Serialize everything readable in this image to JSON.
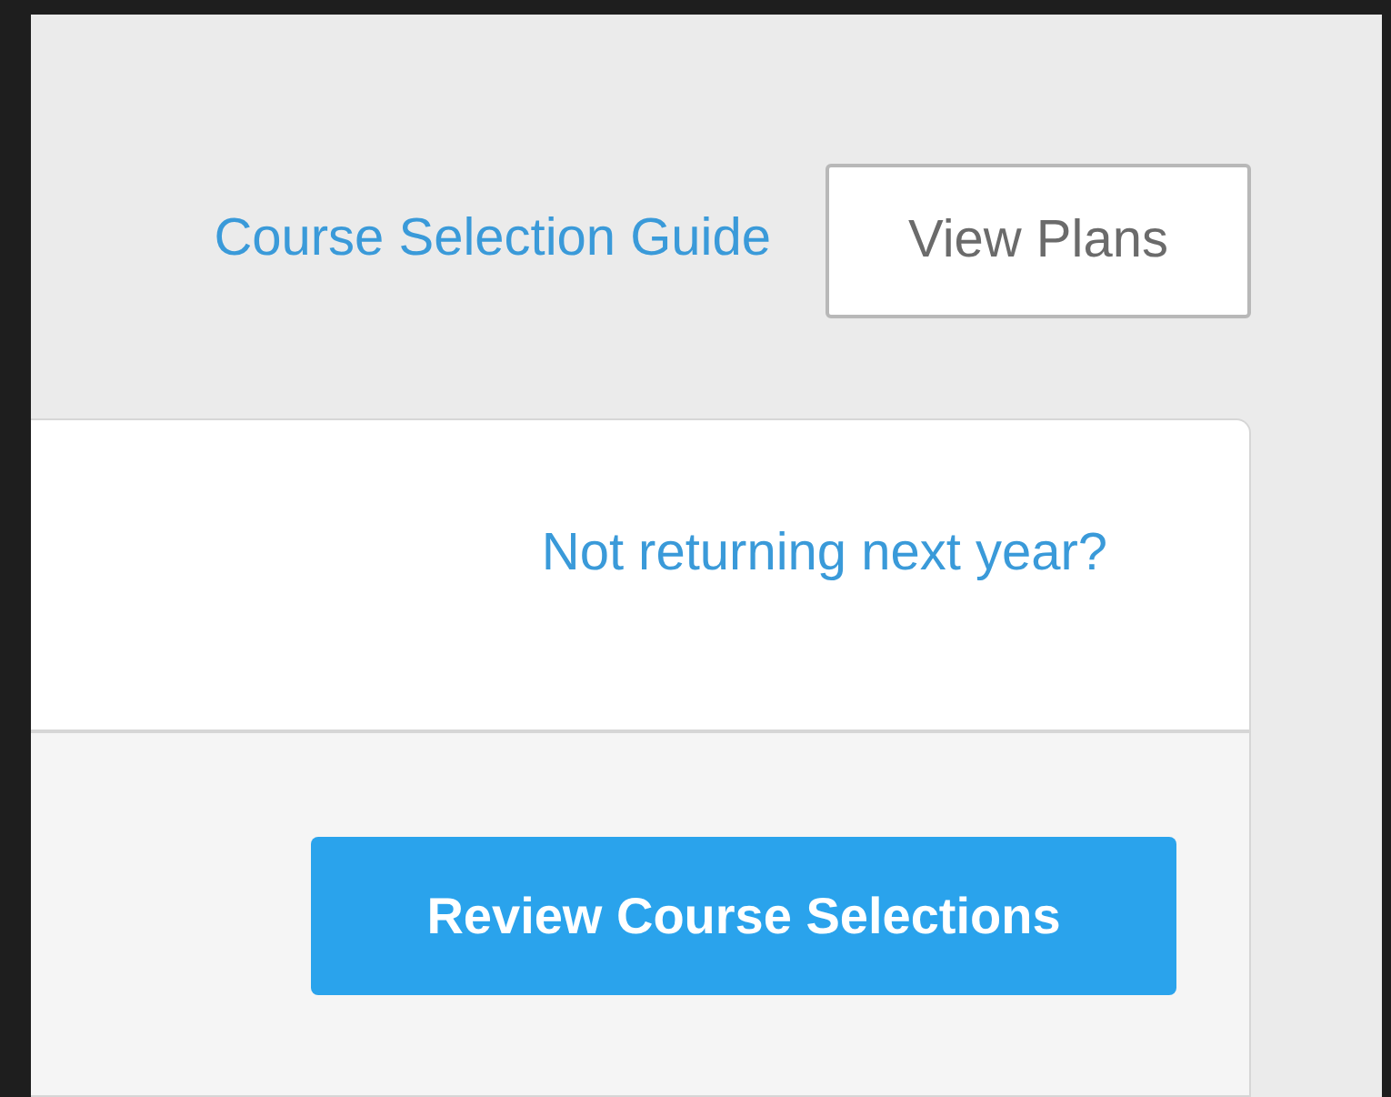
{
  "header": {
    "guide_link": "Course Selection Guide",
    "view_plans_button": "View Plans"
  },
  "card": {
    "not_returning_link": "Not returning next year?",
    "review_button": "Review Course Selections"
  }
}
